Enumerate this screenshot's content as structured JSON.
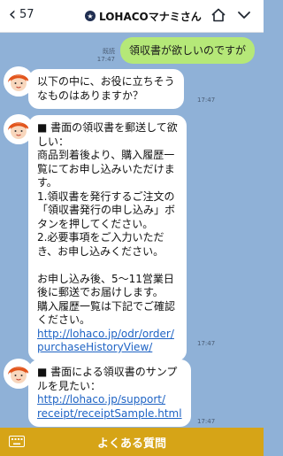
{
  "header": {
    "back_count": "57",
    "title": "LOHACOマナミさん"
  },
  "chat": {
    "sent": {
      "text": "領収書が欲しいのですが",
      "read": "既読",
      "time": "17:47"
    },
    "messages": [
      {
        "text": "以下の中に、お役に立ちそう\nなものはありますか？",
        "time": "17:47"
      },
      {
        "text": "■ 書面の領収書を郵送して欲\nしい：\n商品到着後より、購入履歴一\n覧にてお申し込みいただけま\nす。\n1.領収書を発行するご注文の\n「領収書発行の申し込み」ボ\nタンを押してください。\n2.必要事項をご入力いただ\nき、お申し込みください。\n\nお申し込み後、5～11営業日\n後に郵送でお届けします。\n購入履歴一覧は下記でご確認\nください。",
        "link": [
          "http://lohaco.jp/odr/order/",
          "purchaseHistoryView/"
        ],
        "time": "17:47"
      },
      {
        "text": "■ 書面による領収書のサンプ\nルを見たい：",
        "link": [
          "http://lohaco.jp/support/",
          "receipt/receiptSample.html"
        ],
        "time": "17:47"
      }
    ]
  },
  "footer": {
    "label": "よくある質問"
  },
  "colors": {
    "background": "#8fb1d7",
    "sent_bubble": "#b5e878",
    "footer": "#d6a417",
    "link": "#1e63c4"
  },
  "icons": [
    "back-arrow-icon",
    "verified-badge-icon",
    "home-icon",
    "chevron-down-icon",
    "avatar-icon",
    "keyboard-icon"
  ]
}
